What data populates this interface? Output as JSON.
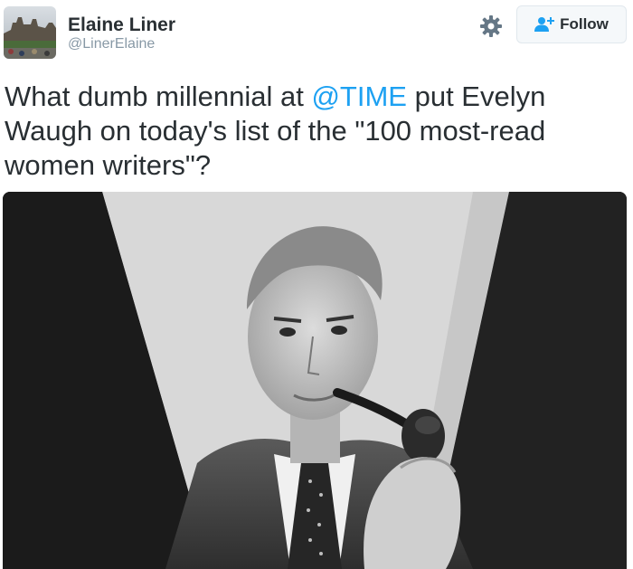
{
  "user": {
    "name": "Elaine Liner",
    "handle": "@LinerElaine",
    "avatar": "profile-photo-castle"
  },
  "actions": {
    "gear_icon": "gear-icon",
    "follow_icon": "follow-person-plus-icon",
    "follow_label": "Follow"
  },
  "tweet": {
    "text_before": "What dumb millennial at ",
    "mention": "@TIME",
    "text_after": " put Evelyn Waugh on today's list of the \"100 most-read women writers\"?"
  },
  "media": {
    "type": "black-and-white-photo",
    "description_icon": "portrait-photo"
  },
  "colors": {
    "accent": "#1da1f2",
    "text": "#292f33",
    "muted": "#8899a6",
    "border": "#e1e8ed"
  }
}
